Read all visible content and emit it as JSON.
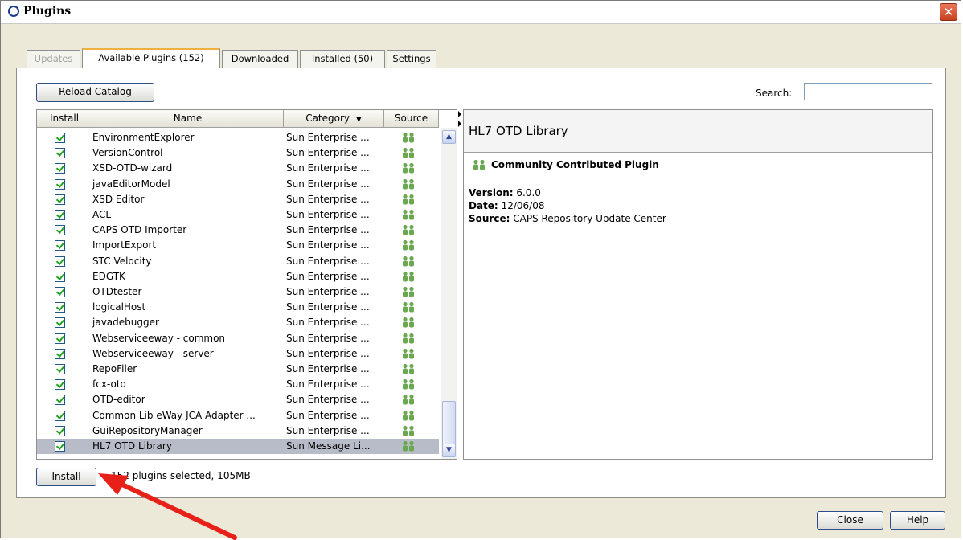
{
  "window": {
    "title": "Plugins",
    "close_glyph": "✕"
  },
  "tabs": [
    {
      "label": "Updates",
      "state": "disabled"
    },
    {
      "label": "Available Plugins (152)",
      "state": "active"
    },
    {
      "label": "Downloaded",
      "state": "normal"
    },
    {
      "label": "Installed (50)",
      "state": "normal"
    },
    {
      "label": "Settings",
      "state": "normal"
    }
  ],
  "toolbar": {
    "reload_label": "Reload Catalog",
    "search_label": "Search:",
    "search_value": ""
  },
  "table": {
    "columns": {
      "install": "Install",
      "name": "Name",
      "category": "Category",
      "category_sort_glyph": "▼",
      "source": "Source"
    },
    "rows": [
      {
        "name": "EnvironmentExplorer",
        "category": "Sun Enterprise ...",
        "checked": true
      },
      {
        "name": "VersionControl",
        "category": "Sun Enterprise ...",
        "checked": true
      },
      {
        "name": "XSD-OTD-wizard",
        "category": "Sun Enterprise ...",
        "checked": true
      },
      {
        "name": "javaEditorModel",
        "category": "Sun Enterprise ...",
        "checked": true
      },
      {
        "name": "XSD Editor",
        "category": "Sun Enterprise ...",
        "checked": true
      },
      {
        "name": "ACL",
        "category": "Sun Enterprise ...",
        "checked": true
      },
      {
        "name": "CAPS OTD Importer",
        "category": "Sun Enterprise ...",
        "checked": true
      },
      {
        "name": "ImportExport",
        "category": "Sun Enterprise ...",
        "checked": true
      },
      {
        "name": "STC Velocity",
        "category": "Sun Enterprise ...",
        "checked": true
      },
      {
        "name": "EDGTK",
        "category": "Sun Enterprise ...",
        "checked": true
      },
      {
        "name": "OTDtester",
        "category": "Sun Enterprise ...",
        "checked": true
      },
      {
        "name": "logicalHost",
        "category": "Sun Enterprise ...",
        "checked": true
      },
      {
        "name": "javadebugger",
        "category": "Sun Enterprise ...",
        "checked": true
      },
      {
        "name": "Webserviceeway - common",
        "category": "Sun Enterprise ...",
        "checked": true
      },
      {
        "name": "Webserviceeway - server",
        "category": "Sun Enterprise ...",
        "checked": true
      },
      {
        "name": "RepoFiler",
        "category": "Sun Enterprise ...",
        "checked": true
      },
      {
        "name": "fcx-otd",
        "category": "Sun Enterprise ...",
        "checked": true
      },
      {
        "name": "OTD-editor",
        "category": "Sun Enterprise ...",
        "checked": true
      },
      {
        "name": "Common Lib eWay JCA Adapter ...",
        "category": "Sun Enterprise ...",
        "checked": true
      },
      {
        "name": "GuiRepositoryManager",
        "category": "Sun Enterprise ...",
        "checked": true
      },
      {
        "name": "HL7 OTD Library",
        "category": "Sun Message Li...",
        "checked": true,
        "selected": true
      }
    ]
  },
  "details": {
    "title": "HL7 OTD Library",
    "badge": "Community Contributed Plugin",
    "version_label": "Version:",
    "version": "6.0.0",
    "date_label": "Date:",
    "date": "12/06/08",
    "source_label": "Source:",
    "source": "CAPS Repository Update Center"
  },
  "footer": {
    "install_label": "Install",
    "status": "152 plugins selected, 105MB"
  },
  "dialog_buttons": {
    "close_label": "Close",
    "help_label": "Help"
  },
  "colors": {
    "accent_tab": "#f0b040",
    "selection": "#b8bcc8",
    "check": "#21a121",
    "annotation_arrow": "#e8201a",
    "source_icon": "#6aa84f"
  }
}
